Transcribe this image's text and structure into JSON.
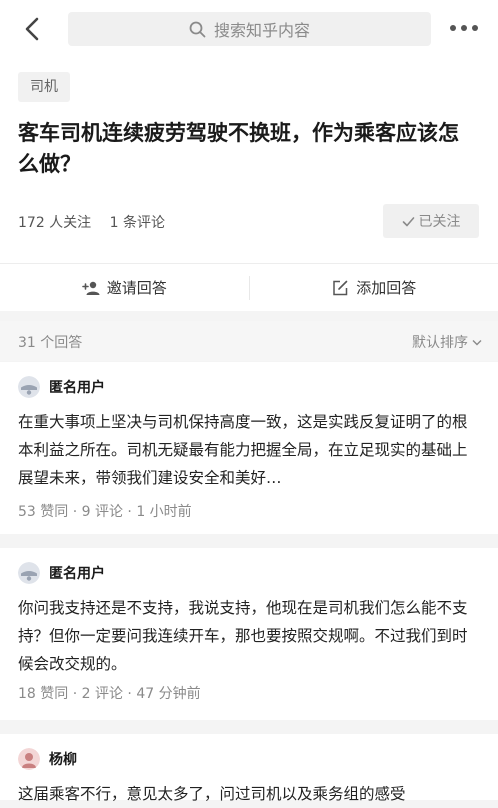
{
  "search": {
    "placeholder": "搜索知乎内容"
  },
  "question": {
    "topic": "司机",
    "title": "客车司机连续疲劳驾驶不换班，作为乘客应该怎么做？",
    "followers": "172 人关注",
    "comments": "1 条评论",
    "follow_label": "已关注"
  },
  "actions": {
    "invite": "邀请回答",
    "add": "添加回答"
  },
  "answers_header": {
    "count": "31 个回答",
    "sort": "默认排序"
  },
  "answers": [
    {
      "author": "匿名用户",
      "content": "在重大事项上坚决与司机保持高度一致，这是实践反复证明了的根本利益之所在。司机无疑最有能力把握全局，在立足现实的基础上展望未来，带领我们建设安全和美好…",
      "meta": "53 赞同 · 9 评论 · 1 小时前"
    },
    {
      "author": "匿名用户",
      "content": "你问我支持还是不支持，我说支持，他现在是司机我们怎么能不支持？但你一定要问我连续开车，那也要按照交规啊。不过我们到时候会改交规的。",
      "meta": "18 赞同 · 2 评论 · 47 分钟前"
    },
    {
      "author": "杨柳",
      "content": "这届乘客不行，意见太多了，问过司机以及乘务组的感受"
    }
  ]
}
